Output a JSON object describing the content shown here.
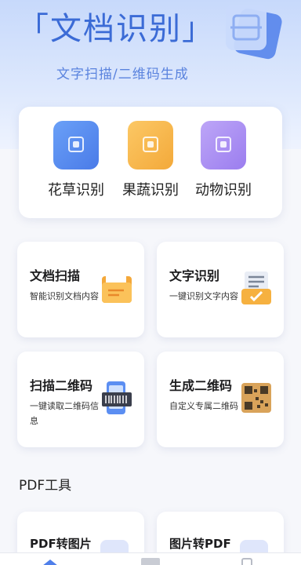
{
  "hero": {
    "title": "「文档识别」",
    "subtitle": "文字扫描/二维码生成",
    "icon": "document-scan-icon"
  },
  "quick_actions": [
    {
      "label": "花草识别",
      "icon": "flower-scan-icon",
      "color": "#5b8ef2"
    },
    {
      "label": "果蔬识别",
      "icon": "fruit-scan-icon",
      "color": "#f7b84a"
    },
    {
      "label": "动物识别",
      "icon": "animal-scan-icon",
      "color": "#a98bf2"
    }
  ],
  "features": [
    {
      "title": "文档扫描",
      "desc": "智能识别文档内容",
      "icon": "folder-document-icon"
    },
    {
      "title": "文字识别",
      "desc": "一键识别文字内容",
      "icon": "text-recognition-icon"
    },
    {
      "title": "扫描二维码",
      "desc": "一键读取二维码信息",
      "icon": "phone-barcode-icon"
    },
    {
      "title": "生成二维码",
      "desc": "自定义专属二维码",
      "icon": "qr-code-icon"
    }
  ],
  "pdf_section": {
    "title": "PDF工具",
    "items": [
      {
        "title": "PDF转图片",
        "icon": "pdf-to-image-icon"
      },
      {
        "title": "图片转PDF",
        "icon": "image-to-pdf-icon"
      }
    ]
  },
  "tabbar": {
    "tabs": [
      {
        "icon": "home-tab-icon"
      },
      {
        "icon": "tools-tab-icon"
      },
      {
        "icon": "profile-tab-icon"
      }
    ]
  }
}
